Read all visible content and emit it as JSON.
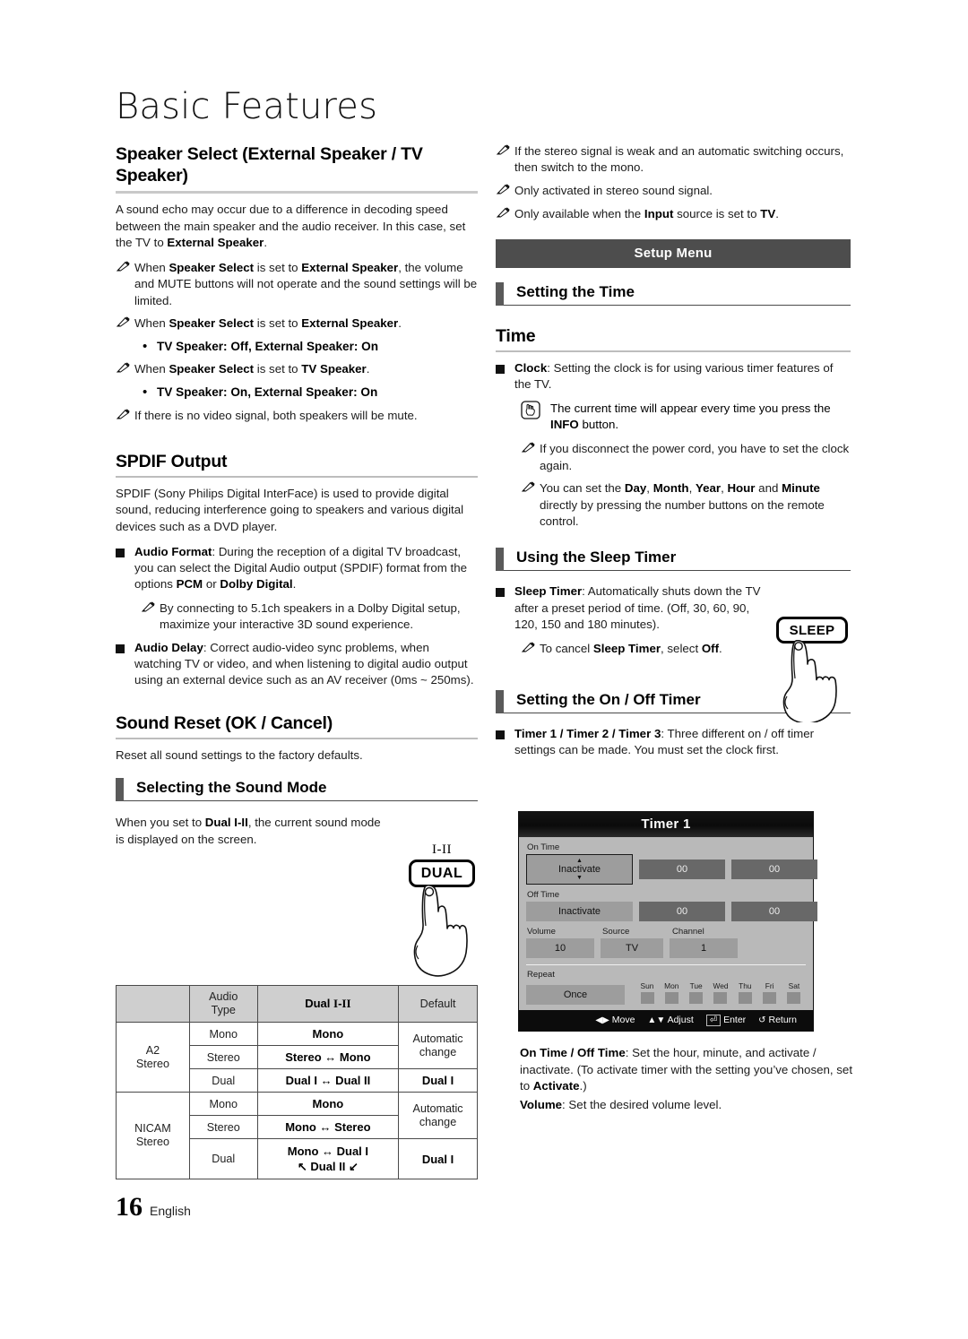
{
  "page": {
    "title": "Basic Features",
    "footer_number": "16",
    "footer_language": "English"
  },
  "left_column": {
    "speaker_select": {
      "heading": "Speaker Select (External Speaker / TV Speaker)",
      "intro_a": "A sound echo may occur due to a difference in decoding speed between the main speaker and the audio receiver. In this case, set the TV to ",
      "intro_b": "External Speaker",
      "intro_c": ".",
      "notes": [
        {
          "pre": "When ",
          "b1": "Speaker Select",
          "mid": " is set to ",
          "b2": "External Speaker",
          "post": ", the volume and MUTE buttons will not operate and the sound settings will be limited."
        },
        {
          "pre": "When ",
          "b1": "Speaker Select",
          "mid": " is set to ",
          "b2": "External Speaker",
          "post": "."
        },
        {
          "pre": "When ",
          "b1": "Speaker Select",
          "mid": " is set to ",
          "b2": "TV Speaker",
          "post": "."
        }
      ],
      "bullet_1": "TV Speaker: Off, External Speaker: On",
      "bullet_2": "TV Speaker: On, External Speaker: On",
      "note_last": "If there is no video signal, both speakers will be mute."
    },
    "spdif": {
      "heading": "SPDIF Output",
      "intro": "SPDIF (Sony Philips Digital InterFace) is used to provide digital sound, reducing interference going to speakers and various digital devices such as a DVD player.",
      "audio_format_label": "Audio Format",
      "audio_format_text": ": During the reception of a digital TV broadcast, you can select the Digital Audio output (SPDIF) format from the options ",
      "audio_format_opt1": "PCM",
      "audio_format_or": " or ",
      "audio_format_opt2": "Dolby Digital",
      "audio_format_end": ".",
      "audio_format_note": "By connecting to 5.1ch speakers in a Dolby Digital setup, maximize your interactive 3D sound experience.",
      "audio_delay_label": "Audio Delay",
      "audio_delay_text": ": Correct audio-video sync problems, when watching TV or video, and when listening to digital audio output using an external device such as an AV receiver (0ms ~ 250ms)."
    },
    "sound_reset": {
      "heading": "Sound Reset (OK / Cancel)",
      "text": "Reset all sound settings to the factory defaults."
    },
    "sound_mode": {
      "heading": "Selecting the Sound Mode",
      "text_a": "When you set to ",
      "text_b": "Dual I-II",
      "text_c": ", the current sound mode is displayed on the screen.",
      "remote_key_top": "I-II",
      "remote_key_label": "DUAL"
    }
  },
  "sound_mode_table": {
    "headers": [
      "",
      "Audio Type",
      "Dual I-II",
      "Default"
    ],
    "rows": [
      {
        "group": "A2 Stereo",
        "type": "Mono",
        "dual": "Mono",
        "default": "Automatic change"
      },
      {
        "group": "A2 Stereo",
        "type": "Stereo",
        "dual": "Stereo ↔ Mono",
        "default": "Automatic change"
      },
      {
        "group": "A2 Stereo",
        "type": "Dual",
        "dual": "Dual I ↔ Dual II",
        "default": "Dual I"
      },
      {
        "group": "NICAM Stereo",
        "type": "Mono",
        "dual": "Mono",
        "default": "Automatic change"
      },
      {
        "group": "NICAM Stereo",
        "type": "Stereo",
        "dual": "Mono ↔ Stereo",
        "default": "Automatic change"
      },
      {
        "group": "NICAM Stereo",
        "type": "Dual",
        "dual": "Mono ↔ Dual I",
        "dual2": "↖ Dual II ↙",
        "default": "Dual I"
      }
    ]
  },
  "right_column": {
    "top_notes": [
      "If the stereo signal is weak and an automatic switching occurs, then switch to the mono.",
      "Only activated in stereo sound signal."
    ],
    "note_input_a": "Only available when the ",
    "note_input_b": "Input",
    "note_input_c": " source is set to ",
    "note_input_d": "TV",
    "note_input_e": ".",
    "banner": "Setup Menu",
    "setting_time_heading": "Setting the Time",
    "time_heading": "Time",
    "clock_label": "Clock",
    "clock_text": ": Setting the clock is for using various timer features of the TV.",
    "clock_hand_note_a": "The current time will appear every time you press the ",
    "clock_hand_note_b": "INFO",
    "clock_hand_note_c": " button.",
    "clock_note_1": "If you disconnect the power cord, you have to set the clock again.",
    "clock_note_2_pre": "You can set the ",
    "clock_note_2_b1": "Day",
    "clock_note_2_b2": "Month",
    "clock_note_2_b3": "Year",
    "clock_note_2_b4": "Hour",
    "clock_note_2_b5": "Minute",
    "clock_note_2_post": " directly by pressing the number buttons on the remote control.",
    "sleep_heading": "Using the Sleep Timer",
    "sleep_label": "Sleep Timer",
    "sleep_text": ": Automatically shuts down the TV after a preset period of time. (Off, 30, 60, 90, 120, 150 and 180 minutes).",
    "sleep_note_a": "To cancel ",
    "sleep_note_b": "Sleep Timer",
    "sleep_note_c": ", select ",
    "sleep_note_d": "Off",
    "sleep_note_e": ".",
    "sleep_remote_label": "SLEEP",
    "onoff_heading": "Setting the On / Off Timer",
    "timer_label": "Timer 1 / Timer 2 / Timer 3",
    "timer_text": ": Three different on / off timer settings can be made. You must set the clock first.",
    "ontime_label": "On Time / Off Time",
    "ontime_text_a": ": Set the hour, minute, and activate / inactivate. (To activate timer with the setting you’ve chosen, set to ",
    "ontime_text_b": "Activate",
    "ontime_text_c": ".)",
    "volume_label": "Volume",
    "volume_text": ": Set the desired volume level."
  },
  "timer_osd": {
    "title": "Timer 1",
    "on_time_label": "On Time",
    "on_time_mode": "Inactivate",
    "on_time_hour": "00",
    "on_time_minute": "00",
    "off_time_label": "Off Time",
    "off_time_mode": "Inactivate",
    "off_time_hour": "00",
    "off_time_minute": "00",
    "volume_label": "Volume",
    "volume_value": "10",
    "source_label": "Source",
    "source_value": "TV",
    "channel_label": "Channel",
    "channel_value": "1",
    "repeat_label": "Repeat",
    "repeat_value": "Once",
    "days": [
      "Sun",
      "Mon",
      "Tue",
      "Wed",
      "Thu",
      "Fri",
      "Sat"
    ],
    "footer": [
      {
        "key": "◀▶",
        "label": "Move"
      },
      {
        "key": "▲▼",
        "label": "Adjust"
      },
      {
        "key": "⏎",
        "label": "Enter"
      },
      {
        "key": "↺",
        "label": "Return"
      }
    ]
  }
}
